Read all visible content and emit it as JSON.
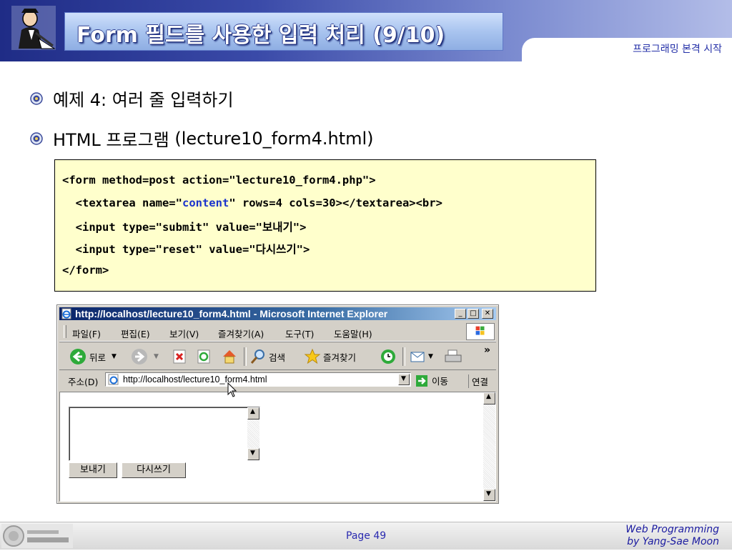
{
  "header": {
    "title": "Form 필드를 사용한 입력 처리 (9/10)",
    "subtitle": "프로그래밍 본격 시작"
  },
  "bullets": [
    {
      "text": "예제 4: 여러 줄 입력하기"
    },
    {
      "text": "HTML 프로그램 ",
      "suffix": "(lecture10_form4.html)"
    }
  ],
  "code": {
    "line1": "<form method=post action=\"lecture10_form4.php\">",
    "line2_pre": "  <textarea name=\"",
    "line2_name": "content",
    "line2_post": "\" rows=4 cols=30></textarea><br>",
    "line3": "  <input type=\"submit\" value=\"보내기\">",
    "line4": "  <input type=\"reset\" value=\"다시쓰기\">",
    "line5": "</form>"
  },
  "browser": {
    "title": "http://localhost/lecture10_form4.html - Microsoft Internet Explorer",
    "window_buttons": {
      "minimize": "_",
      "maximize": "□",
      "close": "✕"
    },
    "menu": [
      "파일(F)",
      "편집(E)",
      "보기(V)",
      "즐겨찾기(A)",
      "도구(T)",
      "도움말(H)"
    ],
    "toolbar": {
      "back": "뒤로",
      "search": "검색",
      "favorites": "즐겨찾기",
      "chevron": "»"
    },
    "address": {
      "label": "주소(D)",
      "value": "http://localhost/lecture10_form4.html",
      "go": "이동",
      "links": "연결"
    },
    "form": {
      "submit_label": "보내기",
      "reset_label": "다시쓰기"
    }
  },
  "footer": {
    "page": "Page 49",
    "line1": "Web Programming",
    "line2": "by Yang-Sae Moon"
  }
}
